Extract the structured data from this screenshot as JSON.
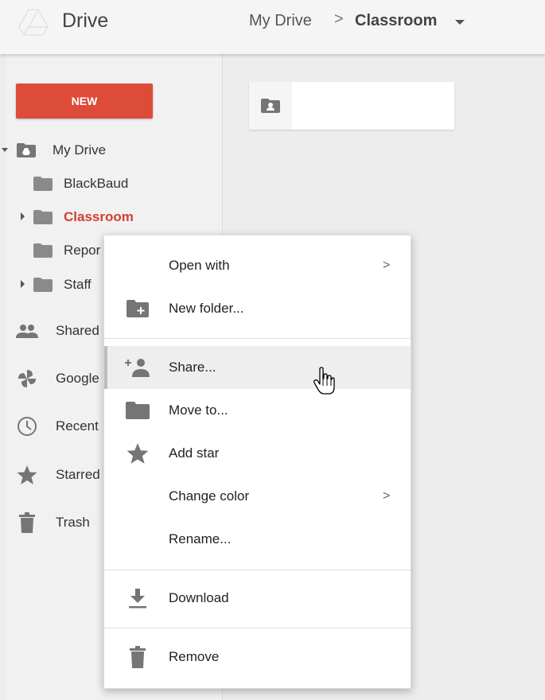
{
  "header": {
    "app_title": "Drive",
    "breadcrumb_root": "My Drive",
    "breadcrumb_separator": ">",
    "breadcrumb_current": "Classroom"
  },
  "sidebar": {
    "new_button": "NEW",
    "tree": {
      "root": "My Drive",
      "folders": [
        "BlackBaud",
        "Classroom",
        "Repor",
        "Staff"
      ]
    },
    "nav": [
      "Shared",
      "Google",
      "Recent",
      "Starred",
      "Trash"
    ]
  },
  "context_menu": {
    "items": [
      {
        "label": "Open with",
        "icon": "none",
        "submenu": true
      },
      {
        "label": "New folder...",
        "icon": "new-folder-icon"
      },
      {
        "label": "Share...",
        "icon": "add-person-icon"
      },
      {
        "label": "Move to...",
        "icon": "folder-icon"
      },
      {
        "label": "Add star",
        "icon": "star-icon"
      },
      {
        "label": "Change color",
        "icon": "none",
        "submenu": true
      },
      {
        "label": "Rename...",
        "icon": "none"
      },
      {
        "label": "Download",
        "icon": "download-icon"
      },
      {
        "label": "Remove",
        "icon": "trash-icon"
      }
    ],
    "submenu_arrow": ">",
    "hovered_item": "Share..."
  },
  "colors": {
    "accent_red": "#dd4b39",
    "active_label": "#d23f31",
    "icon_gray": "#757575"
  }
}
